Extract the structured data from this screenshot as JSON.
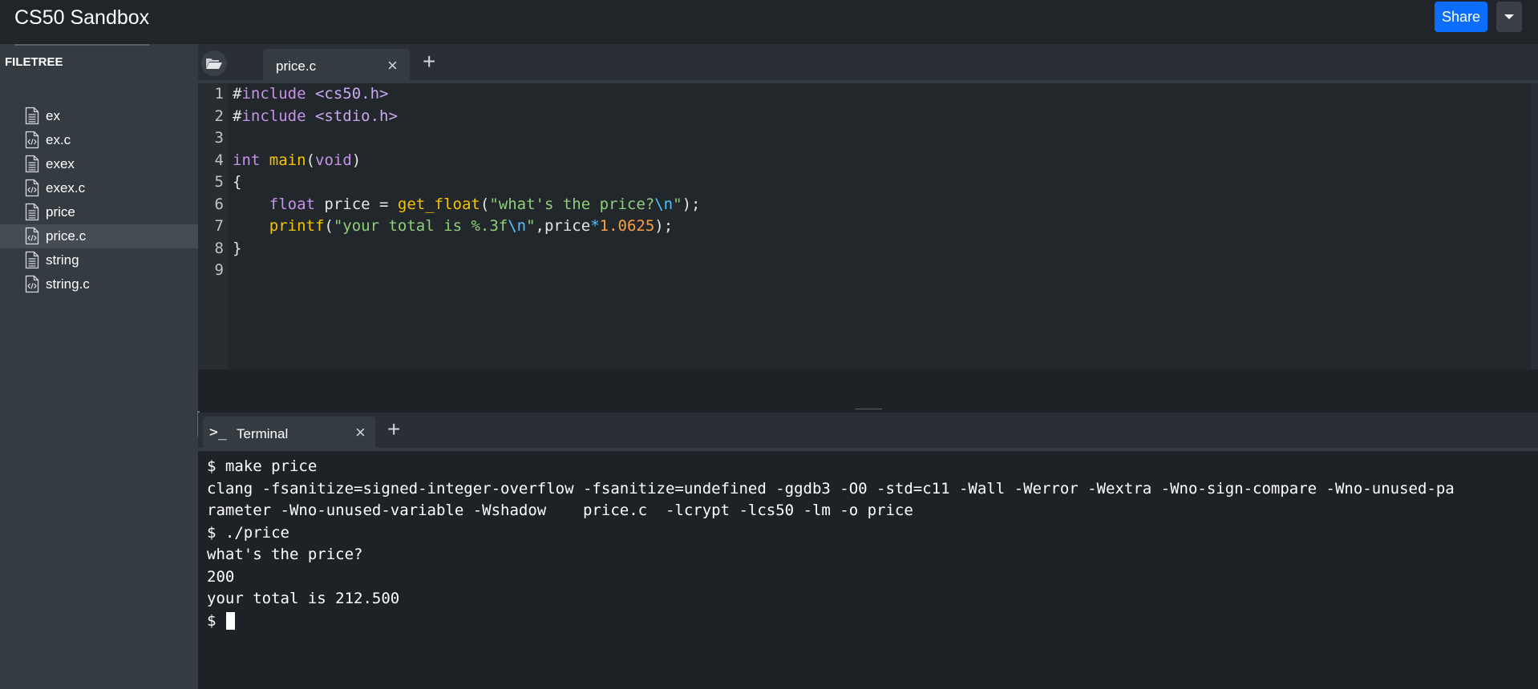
{
  "header": {
    "title": "CS50 Sandbox",
    "share_label": "Share"
  },
  "sidebar": {
    "title": "FILETREE",
    "files": [
      {
        "name": "ex",
        "type": "text"
      },
      {
        "name": "ex.c",
        "type": "code"
      },
      {
        "name": "exex",
        "type": "text"
      },
      {
        "name": "exex.c",
        "type": "code"
      },
      {
        "name": "price",
        "type": "text"
      },
      {
        "name": "price.c",
        "type": "code",
        "selected": true
      },
      {
        "name": "string",
        "type": "text"
      },
      {
        "name": "string.c",
        "type": "code"
      }
    ]
  },
  "editor": {
    "tab_label": "price.c",
    "line_numbers": [
      "1",
      "2",
      "3",
      "4",
      "5",
      "6",
      "7",
      "8",
      "9"
    ],
    "code_lines": [
      "#include <cs50.h>",
      "#include <stdio.h>",
      "",
      "int main(void)",
      "{",
      "    float price = get_float(\"what's the price?\\n\");",
      "    printf(\"your total is %.3f\\n\",price*1.0625);",
      "}",
      ""
    ]
  },
  "terminal": {
    "tab_label": "Terminal",
    "prompt_icon": ">_",
    "lines": [
      "$ make price",
      "clang -fsanitize=signed-integer-overflow -fsanitize=undefined -ggdb3 -O0 -std=c11 -Wall -Werror -Wextra -Wno-sign-compare -Wno-unused-pa",
      "rameter -Wno-unused-variable -Wshadow    price.c  -lcrypt -lcs50 -lm -o price",
      "$ ./price",
      "what's the price?",
      "200",
      "your total is 212.500"
    ],
    "prompt": "$ "
  },
  "colors": {
    "keyword": "#c792ea",
    "type": "#dcb96b",
    "function": "#f5c400",
    "string": "#8fce7a",
    "escape": "#4fc1ff",
    "number": "#ff9f43",
    "operator": "#4fc1ff",
    "include_path": "#c9a8f0"
  },
  "icons": {
    "folder": "folder-open-icon",
    "add": "plus-icon",
    "close": "close-icon",
    "file_text": "file-text-icon",
    "file_code": "file-code-icon",
    "dropdown": "caret-down-icon"
  }
}
